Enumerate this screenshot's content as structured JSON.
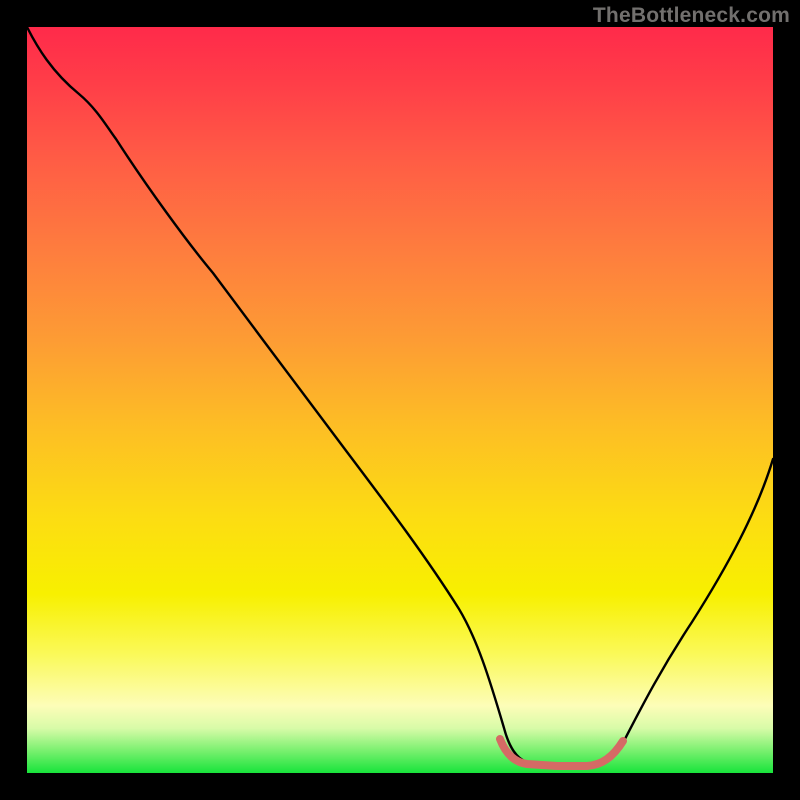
{
  "watermark": "TheBottleneck.com",
  "colors": {
    "frame_bg": "#000000",
    "curve_stroke": "#000000",
    "bottom_segment_stroke": "#d56a65",
    "gradient_stops": [
      {
        "pct": 0,
        "hex": "#ff2a4a"
      },
      {
        "pct": 8,
        "hex": "#ff3f48"
      },
      {
        "pct": 18,
        "hex": "#ff5d45"
      },
      {
        "pct": 30,
        "hex": "#fe7d3e"
      },
      {
        "pct": 42,
        "hex": "#fd9c34"
      },
      {
        "pct": 54,
        "hex": "#fdbf24"
      },
      {
        "pct": 66,
        "hex": "#fcdd12"
      },
      {
        "pct": 76,
        "hex": "#f8f000"
      },
      {
        "pct": 84,
        "hex": "#faf958"
      },
      {
        "pct": 91,
        "hex": "#fdfdb8"
      },
      {
        "pct": 94,
        "hex": "#d8fba8"
      },
      {
        "pct": 97,
        "hex": "#7af06f"
      },
      {
        "pct": 100,
        "hex": "#18e43b"
      }
    ]
  },
  "chart_data": {
    "type": "line",
    "title": "",
    "xlabel": "",
    "ylabel": "",
    "xlim": [
      0,
      100
    ],
    "ylim": [
      0,
      100
    ],
    "categories": [
      0,
      3,
      7,
      12,
      18,
      25,
      32,
      39,
      46,
      53,
      58,
      62,
      64,
      67,
      71,
      75,
      79,
      84,
      89,
      94,
      100
    ],
    "values": [
      100,
      96,
      91,
      85,
      78,
      69,
      60,
      51,
      42,
      32,
      22,
      12,
      5,
      1.5,
      0.8,
      0.8,
      1.2,
      5,
      14,
      26,
      42
    ],
    "bottom_flat_segment": {
      "x_start": 62,
      "x_end": 79,
      "y": 1
    }
  }
}
